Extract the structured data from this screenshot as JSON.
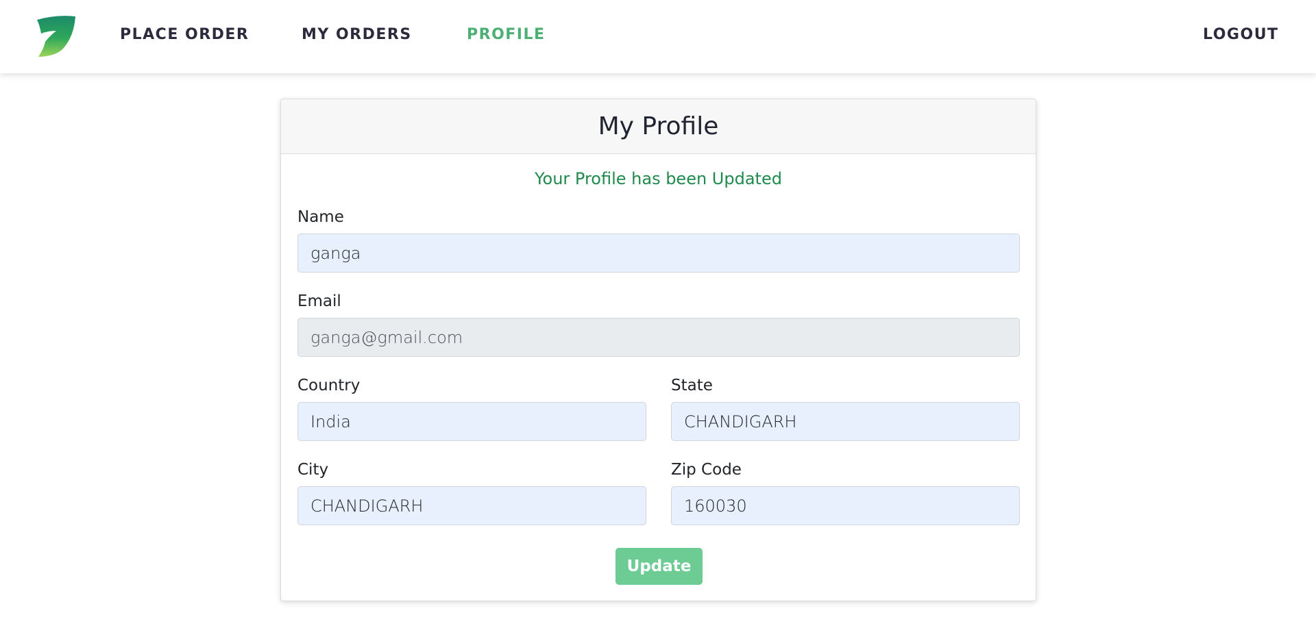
{
  "nav": {
    "logo_icon": "leaf-logo-icon",
    "links": {
      "place_order": "PLACE ORDER",
      "my_orders": "MY ORDERS",
      "profile": "PROFILE",
      "logout": "LOGOUT"
    },
    "active": "profile",
    "active_color": "#4caf73"
  },
  "profile": {
    "title": "My Profile",
    "message": "Your Profile has been Updated",
    "message_color": "#1f8a4c",
    "fields": {
      "name": {
        "label": "Name",
        "value": "ganga"
      },
      "email": {
        "label": "Email",
        "value": "ganga@gmail.com"
      },
      "country": {
        "label": "Country",
        "value": "India"
      },
      "state": {
        "label": "State",
        "value": "CHANDIGARH"
      },
      "city": {
        "label": "City",
        "value": "CHANDIGARH"
      },
      "zip": {
        "label": "Zip Code",
        "value": "160030"
      }
    },
    "update_label": "Update",
    "button_color": "#6dcc93"
  }
}
